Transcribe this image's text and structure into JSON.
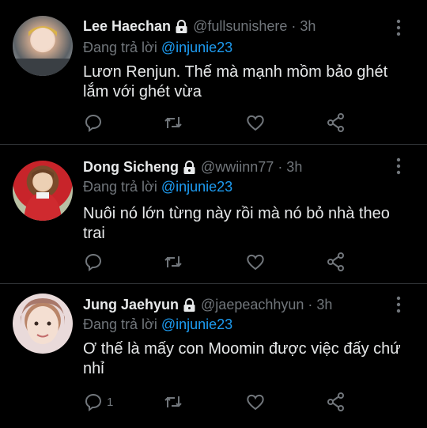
{
  "tweets": [
    {
      "name": "Lee Haechan",
      "handle": "@fullsunishere",
      "time": "· 3h",
      "reply_prefix": "Đang trả lời",
      "reply_to": "@injunie23",
      "text": "Lươn Renjun. Thế mà mạnh mồm bảo ghét lắm với ghét vừa",
      "reply_count": ""
    },
    {
      "name": "Dong Sicheng",
      "handle": "@wwiinn77",
      "time": "· 3h",
      "reply_prefix": "Đang trả lời",
      "reply_to": "@injunie23",
      "text": "Nuôi nó lớn từng này rồi mà nó bỏ nhà theo trai",
      "reply_count": ""
    },
    {
      "name": "Jung Jaehyun",
      "handle": "@jaepeachhyun",
      "time": "· 3h",
      "reply_prefix": "Đang trả lời",
      "reply_to": "@injunie23",
      "text": "Ơ thế là mấy con Moomin được việc đấy chứ nhỉ",
      "reply_count": "1"
    }
  ],
  "colors": {
    "background": "#000000",
    "text": "#e7e9ea",
    "muted": "#71767b",
    "accent": "#1d9bf0",
    "divider": "#2f3336"
  },
  "icons": [
    "lock-icon",
    "more-icon",
    "reply-icon",
    "retweet-icon",
    "like-icon",
    "share-icon"
  ]
}
